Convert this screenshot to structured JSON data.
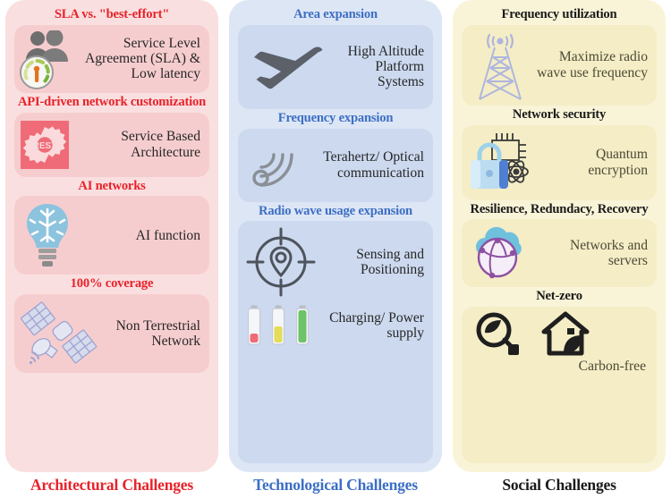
{
  "columns": [
    {
      "id": "architectural",
      "footer": "Architectural Challenges",
      "accent": "#e8232a",
      "panel_bg": "#fadfe0",
      "card_bg": "#f6cdcf",
      "groups": [
        {
          "title": "SLA vs. \"best-effort\"",
          "card": {
            "text": "Service Level Agreement (SLA) & Low latency",
            "icons": [
              "people-icon",
              "speed-gauge-icon"
            ]
          }
        },
        {
          "title": "API-driven network customization",
          "card": {
            "text": "Service Based Architecture",
            "icons": [
              "rest-gear-icon"
            ],
            "icon_label": "REST"
          }
        },
        {
          "title": "AI networks",
          "card": {
            "text": "AI function",
            "icons": [
              "ai-lightbulb-brain-icon"
            ]
          }
        },
        {
          "title": "100% coverage",
          "card": {
            "text": "Non Terrestrial Network",
            "icons": [
              "satellite-icon"
            ]
          }
        }
      ]
    },
    {
      "id": "technological",
      "footer": "Technological Challenges",
      "accent": "#3c6fc4",
      "panel_bg": "#dde6f5",
      "card_bg": "#ccd9ef",
      "groups": [
        {
          "title": "Area expansion",
          "card": {
            "text": "High Altitude Platform Systems",
            "icons": [
              "airplane-icon"
            ]
          }
        },
        {
          "title": "Frequency expansion",
          "card": {
            "text": "Terahertz/ Optical communication",
            "icons": [
              "wifi-signal-icon"
            ]
          }
        },
        {
          "title": "Radio wave usage expansion",
          "card": {
            "text": "Sensing and Positioning",
            "text2": "Charging/ Power supply",
            "icons": [
              "crosshair-location-pin-icon",
              "battery-levels-icon"
            ]
          }
        }
      ]
    },
    {
      "id": "social",
      "footer": "Social Challenges",
      "accent": "#1a1a1a",
      "panel_bg": "#f9f4d8",
      "card_bg": "#f5edc6",
      "groups": [
        {
          "title": "Frequency utilization",
          "card": {
            "text": "Maximize radio wave use frequency",
            "icons": [
              "radio-tower-icon"
            ]
          }
        },
        {
          "title": "Network security",
          "card": {
            "text": "Quantum encryption",
            "icons": [
              "padlock-circuit-atom-icon"
            ]
          }
        },
        {
          "title": "Resilience, Redundacy, Recovery",
          "card": {
            "text": "Networks and servers",
            "icons": [
              "cloud-globe-icon"
            ]
          }
        },
        {
          "title": "Net-zero",
          "card": {
            "text": "Carbon-free",
            "icons": [
              "leaf-plug-icon",
              "eco-house-icon"
            ]
          }
        }
      ]
    }
  ]
}
